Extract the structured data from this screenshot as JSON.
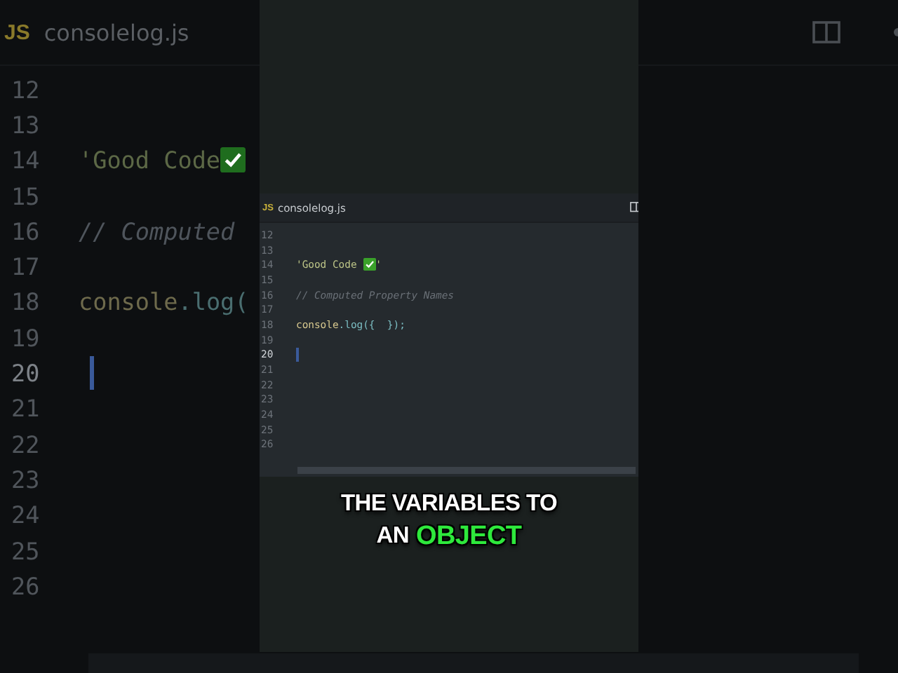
{
  "background_editor": {
    "tab": {
      "badge": "JS",
      "filename": "consolelog.js"
    },
    "lines": [
      {
        "number": "12",
        "active": false
      },
      {
        "number": "13",
        "active": false
      },
      {
        "number": "14",
        "active": false,
        "tokens": [
          {
            "kind": "string",
            "text": "'Good Code"
          },
          {
            "kind": "check"
          }
        ]
      },
      {
        "number": "15",
        "active": false
      },
      {
        "number": "16",
        "active": false,
        "tokens": [
          {
            "kind": "comment",
            "text": "// Computed"
          }
        ]
      },
      {
        "number": "17",
        "active": false
      },
      {
        "number": "18",
        "active": false,
        "tokens": [
          {
            "kind": "object",
            "text": "console"
          },
          {
            "kind": "method",
            "text": ".log("
          }
        ]
      },
      {
        "number": "19",
        "active": false
      },
      {
        "number": "20",
        "active": true
      },
      {
        "number": "21",
        "active": false
      },
      {
        "number": "22",
        "active": false
      },
      {
        "number": "23",
        "active": false
      },
      {
        "number": "24",
        "active": false
      },
      {
        "number": "25",
        "active": false
      },
      {
        "number": "26",
        "active": false
      }
    ]
  },
  "editor": {
    "tab": {
      "badge": "JS",
      "filename": "consolelog.js"
    },
    "lines": [
      {
        "number": "12",
        "active": false
      },
      {
        "number": "13",
        "active": false
      },
      {
        "number": "14",
        "active": false,
        "tokens": [
          {
            "kind": "string",
            "text": "'Good Code "
          },
          {
            "kind": "check"
          },
          {
            "kind": "string",
            "text": "'"
          }
        ]
      },
      {
        "number": "15",
        "active": false
      },
      {
        "number": "16",
        "active": false,
        "tokens": [
          {
            "kind": "comment",
            "text": "// Computed Property Names"
          }
        ]
      },
      {
        "number": "17",
        "active": false
      },
      {
        "number": "18",
        "active": false,
        "tokens": [
          {
            "kind": "object",
            "text": "console"
          },
          {
            "kind": "method",
            "text": ".log({  });"
          }
        ]
      },
      {
        "number": "19",
        "active": false
      },
      {
        "number": "20",
        "active": true
      },
      {
        "number": "21",
        "active": false
      },
      {
        "number": "22",
        "active": false
      },
      {
        "number": "23",
        "active": false
      },
      {
        "number": "24",
        "active": false
      },
      {
        "number": "25",
        "active": false
      },
      {
        "number": "26",
        "active": false
      }
    ]
  },
  "caption": {
    "lines": [
      [
        {
          "text": "THE VARIABLES TO",
          "highlight": false
        }
      ],
      [
        {
          "text": "AN",
          "highlight": false
        },
        {
          "text": "OBJECT",
          "highlight": true
        }
      ]
    ]
  }
}
